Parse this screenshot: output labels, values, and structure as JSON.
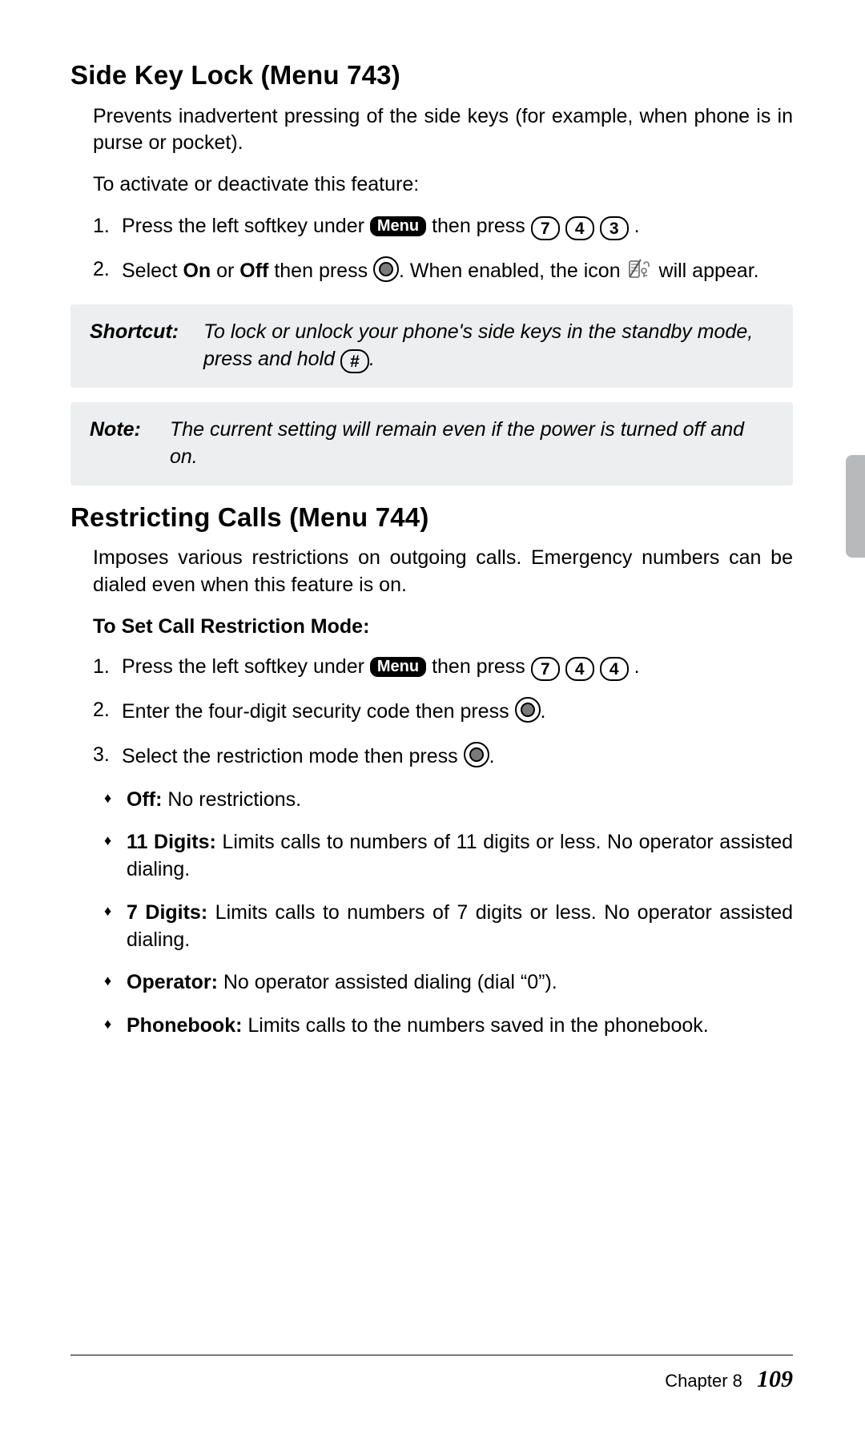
{
  "section1": {
    "heading": "Side Key Lock (Menu 743)",
    "p1": "Prevents inadvertent pressing of the side keys (for example, when phone is in purse or pocket).",
    "p2": "To activate or deactivate this feature:",
    "step1_a": "Press the left softkey under ",
    "menu_label": "Menu",
    "step1_b": " then press ",
    "k7": "7",
    "k4": "4",
    "k3": "3",
    "step1_c": ".",
    "step2_a": "Select ",
    "on": "On",
    "or": " or ",
    "off": "Off",
    "step2_b": " then press ",
    "step2_c": ". When enabled, the icon ",
    "step2_d": " will appear.",
    "shortcut_label": "Shortcut:",
    "shortcut_body_a": "To lock or unlock your phone's side keys in the standby mode, press and hold ",
    "hash": "#",
    "shortcut_body_b": ".",
    "note_label": "Note:",
    "note_body": "The current setting will remain even if the power is turned off and on."
  },
  "section2": {
    "heading": "Restricting Calls (Menu 744)",
    "p1": "Imposes various restrictions on outgoing calls. Emergency numbers can be dialed even when this feature is on.",
    "subhead": "To Set Call Restriction Mode:",
    "step1_a": "Press the left softkey under ",
    "step1_b": " then press ",
    "k7": "7",
    "k4a": "4",
    "k4b": "4",
    "step1_c": ".",
    "step2_a": "Enter the four-digit security code then press ",
    "step2_b": ".",
    "step3_a": "Select the restriction mode then press ",
    "step3_b": ".",
    "b1_label": "Off:",
    "b1_text": " No restrictions.",
    "b2_label": "11 Digits:",
    "b2_text": " Limits calls to numbers of 11 digits or less. No operator assisted dialing.",
    "b3_label": "7 Digits:",
    "b3_text": " Limits calls to numbers of 7 digits or less. No operator assisted dialing.",
    "b4_label": "Operator:",
    "b4_text": " No operator assisted dialing (dial “0”).",
    "b5_label": "Phonebook:",
    "b5_text": " Limits calls to the numbers saved in the phonebook."
  },
  "footer": {
    "chapter": "Chapter 8",
    "page": "109"
  },
  "icons": {
    "diamond": "♦"
  }
}
